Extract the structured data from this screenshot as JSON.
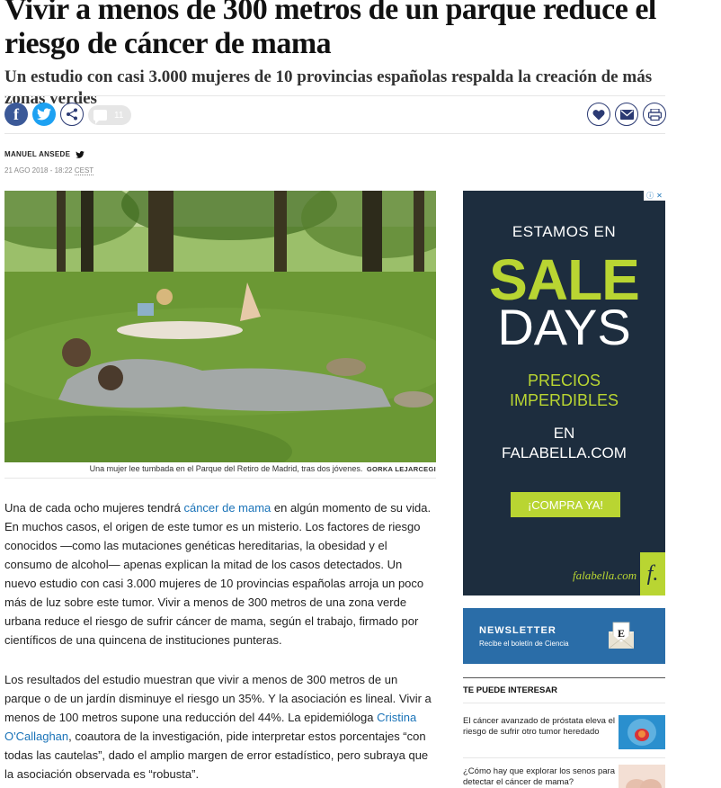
{
  "article": {
    "headline": "Vivir a menos de 300 metros de un parque reduce el riesgo de cáncer de mama",
    "subheadline": "Un estudio con casi 3.000 mujeres de 10 provincias españolas respalda la creación de más zonas verdes",
    "author": "MANUEL ANSEDE",
    "date": "21 AGO 2018 - 18:22",
    "timezone": "CEST",
    "photo_caption": "Una mujer lee tumbada en el Parque del Retiro de Madrid, tras dos jóvenes.",
    "photo_credit": "GORKA LEJARCEGI",
    "p1_before_link": "Una de cada ocho mujeres tendrá ",
    "p1_link": "cáncer de mama",
    "p1_after_link": " en algún momento de su vida. En muchos casos, el origen de este tumor es un misterio. Los factores de riesgo conocidos —como las mutaciones genéticas hereditarias, la obesidad y el consumo de alcohol— apenas explican la mitad de los casos detectados. Un nuevo estudio con casi 3.000 mujeres de 10 provincias españolas arroja un poco más de luz sobre este tumor. Vivir a menos de 300 metros de una zona verde urbana reduce el riesgo de sufrir cáncer de mama, según el trabajo, firmado por científicos de una quincena de instituciones punteras.",
    "p2_before_link": "Los resultados del estudio muestran que vivir a menos de 300 metros de un parque o de un jardín disminuye el riesgo un 35%. Y la asociación es lineal. Vivir a menos de 100 metros supone una reducción del 44%. La epidemióloga ",
    "p2_link": "Cristina O'Callaghan",
    "p2_after_link": ", coautora de la investigación, pide interpretar estos porcentajes “con todas las cautelas”, dado el amplio margen de error estadístico, pero subraya que la asociación observada es “robusta”."
  },
  "share": {
    "facebook_glyph": "f",
    "comment_count": "11"
  },
  "ad": {
    "line1": "ESTAMOS EN",
    "line2": "SALE",
    "line3": "DAYS",
    "line4a": "PRECIOS",
    "line4b": "IMPERDIBLES",
    "line5a": "EN",
    "line5b": "FALABELLA.COM",
    "cta": "¡COMPRA YA!",
    "brand": "falabella.com",
    "brand_logo": "f.",
    "accent_color": "#b9d532",
    "bg_color": "#1d2d3e"
  },
  "newsletter": {
    "title": "NEWSLETTER",
    "subtitle": "Recibe el boletín de Ciencia"
  },
  "related": {
    "title": "TE PUEDE INTERESAR",
    "items": [
      {
        "text": "El cáncer avanzado de próstata eleva el riesgo de sufrir otro tumor heredado"
      },
      {
        "text": "¿Cómo hay que explorar los senos para detectar el cáncer de mama?"
      }
    ]
  }
}
